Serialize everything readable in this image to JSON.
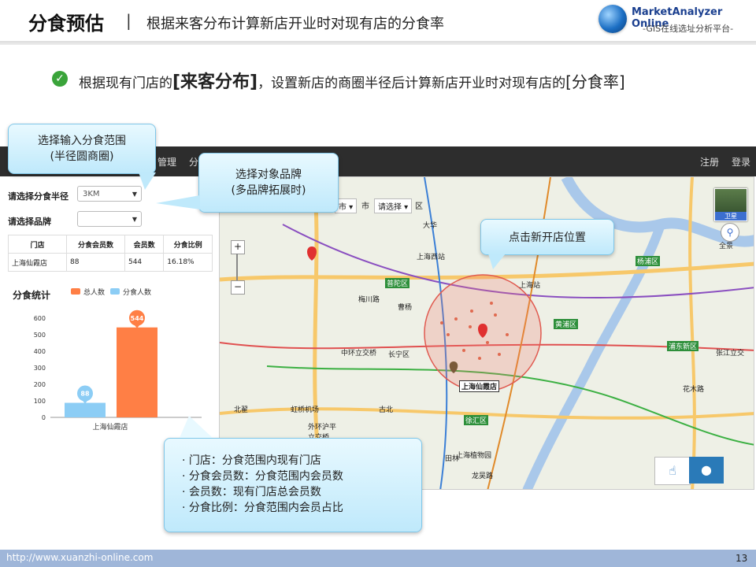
{
  "header": {
    "title": "分食预估",
    "separator": "|",
    "subtitle": "根据来客分布计算新店开业时对现有店的分食率",
    "brand": "MarketAnalyzer Online",
    "brand_sub": "-GIS在线选址分析平台-"
  },
  "intro": {
    "p1": "根据现有门店的",
    "h1": "[来客分布]",
    "p2": "，设置新店的商圈半径后计算新店开业时对现有店的",
    "h2": "[分食率]"
  },
  "topbar": {
    "menu_partial_1": "管理",
    "menu_partial_2": "分食",
    "register": "注册",
    "login": "登录"
  },
  "form": {
    "radius_label": "请选择分食半径",
    "radius_value": "3KM",
    "brand_label": "请选择品牌",
    "brand_value": ""
  },
  "table": {
    "headers": [
      "门店",
      "分食会员数",
      "会员数",
      "分食比例"
    ],
    "rows": [
      [
        "上海仙霞店",
        "88",
        "544",
        "16.18%"
      ]
    ]
  },
  "stats": {
    "title": "分食统计",
    "legend": [
      {
        "name": "总人数",
        "color": "#ff7f45"
      },
      {
        "name": "分食人数",
        "color": "#8ccdf5"
      }
    ]
  },
  "chart_data": {
    "type": "bar",
    "categories": [
      "上海仙霞店"
    ],
    "series": [
      {
        "name": "分食人数",
        "values": [
          88
        ],
        "color": "#8ccdf5"
      },
      {
        "name": "总人数",
        "values": [
          544
        ],
        "color": "#ff7f45"
      }
    ],
    "ylim": [
      0,
      600
    ],
    "yticks": [
      0,
      100,
      200,
      300,
      400,
      500,
      600
    ],
    "data_labels": [
      "88",
      "544"
    ]
  },
  "map": {
    "province_suffix": "市",
    "city_suffix": "市",
    "city_select": "请选择",
    "district_suffix": "区",
    "satellite_label": "卫星",
    "panorama_label": "全景",
    "store_label": "上海仙霞店",
    "places": [
      "大华",
      "上海西站",
      "普陀区",
      "梅川路",
      "曹杨",
      "中环立交桥",
      "长宁区",
      "上海站",
      "黄浦区",
      "浦东新区",
      "杨浦区",
      "徐汇区",
      "虹桥机场",
      "北翟",
      "上海植物园",
      "龙吴路",
      "田林",
      "古北",
      "张江立交",
      "花木路",
      "外环沪平立交桥"
    ],
    "zoom_in": "+",
    "zoom_out": "−"
  },
  "callouts": {
    "radius": [
      "选择输入分食范围",
      "(半径圆商圈)"
    ],
    "brand": [
      "选择对象品牌",
      "(多品牌拓展时)"
    ],
    "click": "点击新开店位置",
    "notes": [
      "· 门店：分食范围内现有门店",
      "· 分食会员数：分食范围内会员数",
      "· 会员数：现有门店总会员数",
      "· 分食比例：分食范围内会员占比"
    ]
  },
  "footer": {
    "url": "http://www.xuanzhi-online.com",
    "page": "13"
  },
  "colors": {
    "accent": "#1a3f8f",
    "bar_total": "#ff7f45",
    "bar_share": "#8ccdf5",
    "footer": "#9fb6d9"
  }
}
